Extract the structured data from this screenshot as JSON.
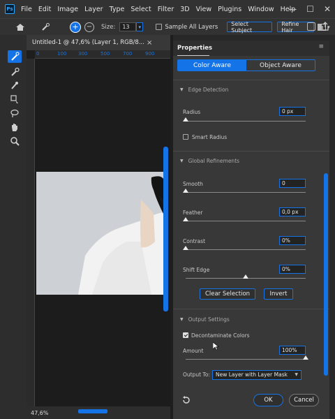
{
  "app": {
    "logo": "Ps"
  },
  "menubar": {
    "items": [
      "File",
      "Edit",
      "Image",
      "Layer",
      "Type",
      "Select",
      "Filter",
      "3D",
      "View",
      "Plugins",
      "Window",
      "Help"
    ]
  },
  "window_controls": {
    "minimize": "—",
    "maximize": "☐",
    "close": "✕"
  },
  "options": {
    "size_label": "Size:",
    "size_value": "13",
    "sample_all_layers_label": "Sample All Layers",
    "select_subject_label": "Select Subject",
    "refine_hair_label": "Refine Hair"
  },
  "document": {
    "tab_title": "Untitled-1 @ 47,6% (Layer 1, RGB/8...",
    "close_glyph": "×",
    "ruler_labels": [
      "0",
      "100",
      "300",
      "500",
      "700",
      "900"
    ],
    "zoom": "47,6%"
  },
  "properties": {
    "title": "Properties",
    "menu_glyph": "≡",
    "view_modes": [
      "Color Aware",
      "Object Aware"
    ],
    "active_view_mode": "Color Aware",
    "edge_detection": {
      "header": "Edge Detection",
      "radius_label": "Radius",
      "radius_value": "0 px",
      "radius_level": 0,
      "smart_radius_label": "Smart Radius",
      "smart_radius_checked": false
    },
    "global_refinements": {
      "header": "Global Refinements",
      "smooth_label": "Smooth",
      "smooth_value": "0",
      "smooth_level": 0,
      "feather_label": "Feather",
      "feather_value": "0,0 px",
      "feather_level": 0,
      "contrast_label": "Contrast",
      "contrast_value": "0%",
      "contrast_level": 0,
      "shift_edge_label": "Shift Edge",
      "shift_edge_value": "0%",
      "shift_edge_level": 0.5
    },
    "buttons": {
      "clear_selection": "Clear Selection",
      "invert": "Invert"
    },
    "output_settings": {
      "header": "Output Settings",
      "decontaminate_label": "Decontaminate Colors",
      "decontaminate_checked": true,
      "amount_label": "Amount",
      "amount_value": "100%",
      "amount_level": 1.0,
      "output_to_label": "Output To:",
      "output_to_value": "New Layer with Layer Mask"
    },
    "footer": {
      "ok": "OK",
      "cancel": "Cancel"
    }
  },
  "colors": {
    "accent": "#1473e6",
    "panel": "#383838",
    "background": "#282828"
  }
}
